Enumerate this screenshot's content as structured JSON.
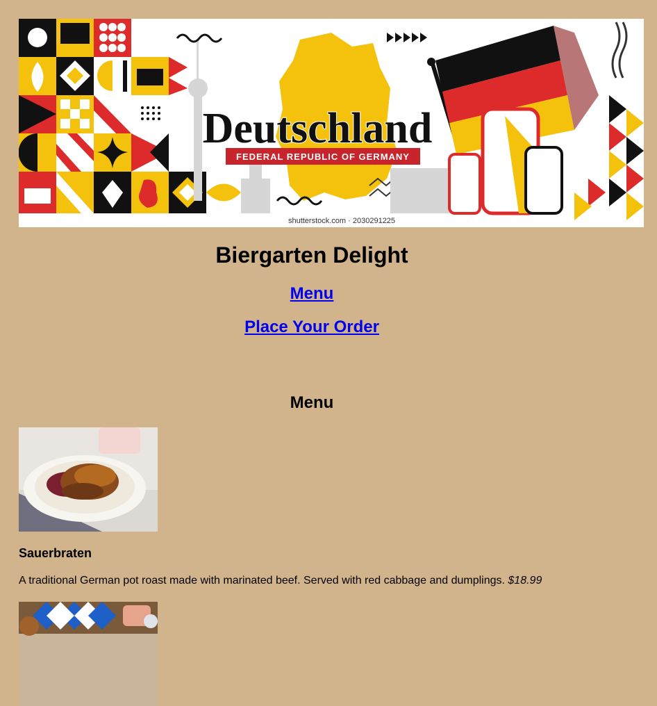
{
  "banner": {
    "title": "Deutschland",
    "subtitle": "FEDERAL REPUBLIC OF GERMANY",
    "watermark": "shutterstock.com · 2030291225",
    "colors": {
      "black": "#111111",
      "red": "#dd2a2a",
      "gold": "#f4c20d"
    }
  },
  "site": {
    "title": "Biergarten Delight"
  },
  "nav": {
    "menu": "Menu",
    "order": "Place Your Order"
  },
  "menu_section": {
    "title": "Menu",
    "items": [
      {
        "name": "Sauerbraten",
        "description": "A traditional German pot roast made with marinated beef. Served with red cabbage and dumplings.",
        "price": "$18.99"
      }
    ]
  },
  "colors": {
    "page_background": "#d2b48c",
    "link": "#0000ee"
  }
}
